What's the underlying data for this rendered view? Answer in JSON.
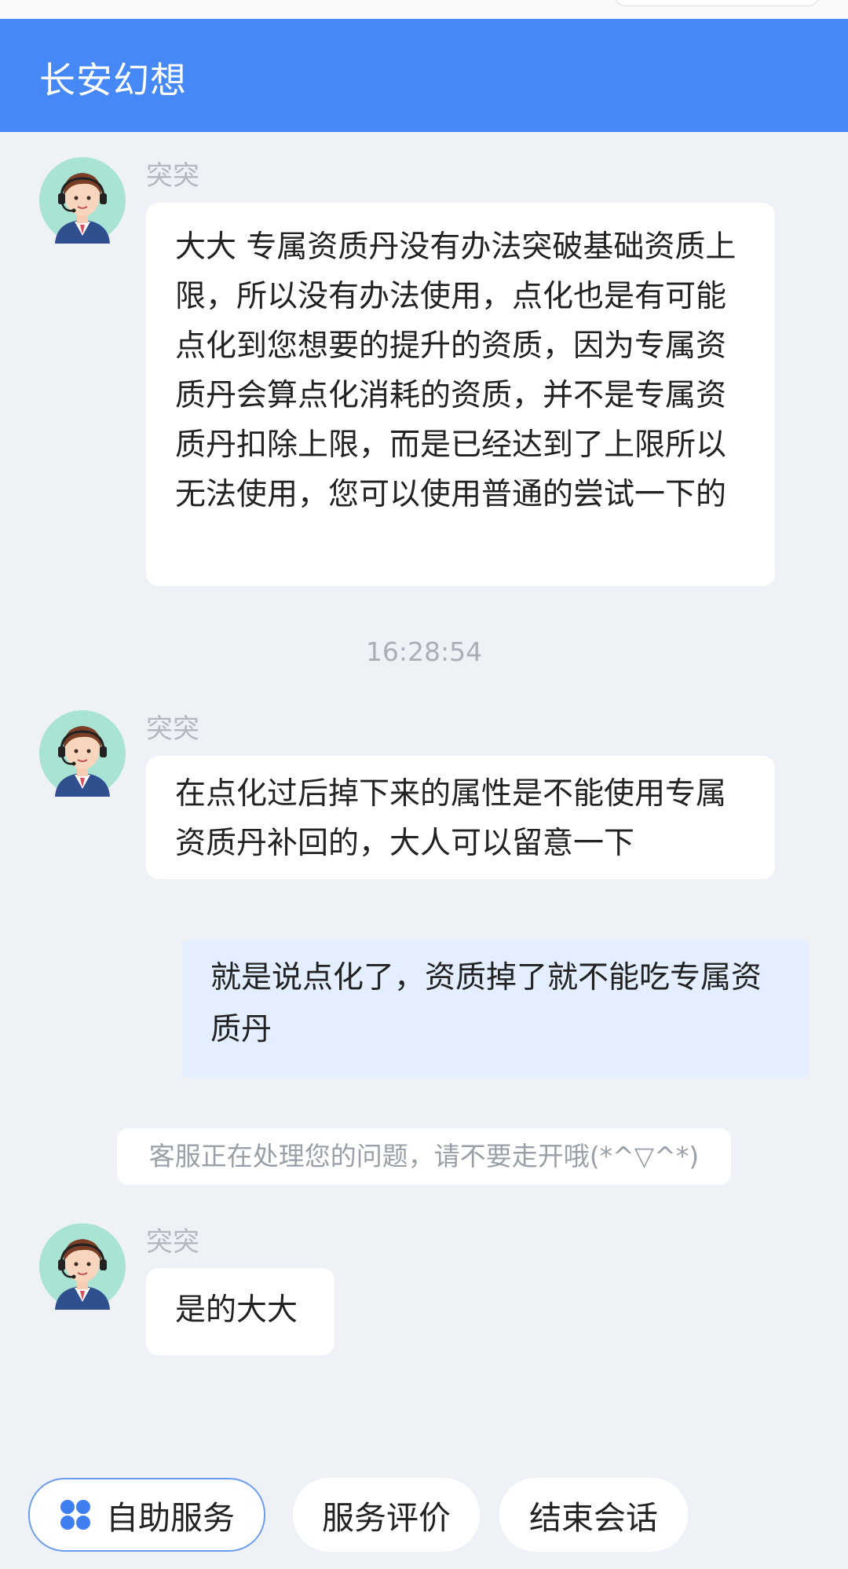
{
  "header": {
    "title": "长安幻想"
  },
  "messages": [
    {
      "sender": "突突",
      "text": "大大 专属资质丹没有办法突破基础资质上限，所以没有办法使用，点化也是有可能点化到您想要的提升的资质，因为专属资质丹会算点化消耗的资质，并不是专属资质丹扣除上限，而是已经达到了上限所以无法使用，您可以使用普通的尝试一下的"
    },
    {
      "sender": "突突",
      "text": "在点化过后掉下来的属性是不能使用专属资质丹补回的，大人可以留意一下"
    },
    {
      "sender": "me",
      "text": "就是说点化了，资质掉了就不能吃专属资质丹"
    },
    {
      "sender": "突突",
      "text": "是的大大"
    }
  ],
  "timestamp": "16:28:54",
  "notice": "客服正在处理您的问题，请不要走开哦(*^▽^*)",
  "bottom_bar": {
    "self_service": "自助服务",
    "rate_service": "服务评价",
    "end_session": "结束会话"
  },
  "colors": {
    "header": "#4689f6",
    "background": "#eef1f6",
    "my_bubble": "#e3efff",
    "agent_bubble": "#ffffff",
    "accent_icon": "#3f7ef0"
  },
  "icons": {
    "agent_avatar": "customer-service-agent-avatar",
    "self_service": "four-petal-grid-icon"
  }
}
